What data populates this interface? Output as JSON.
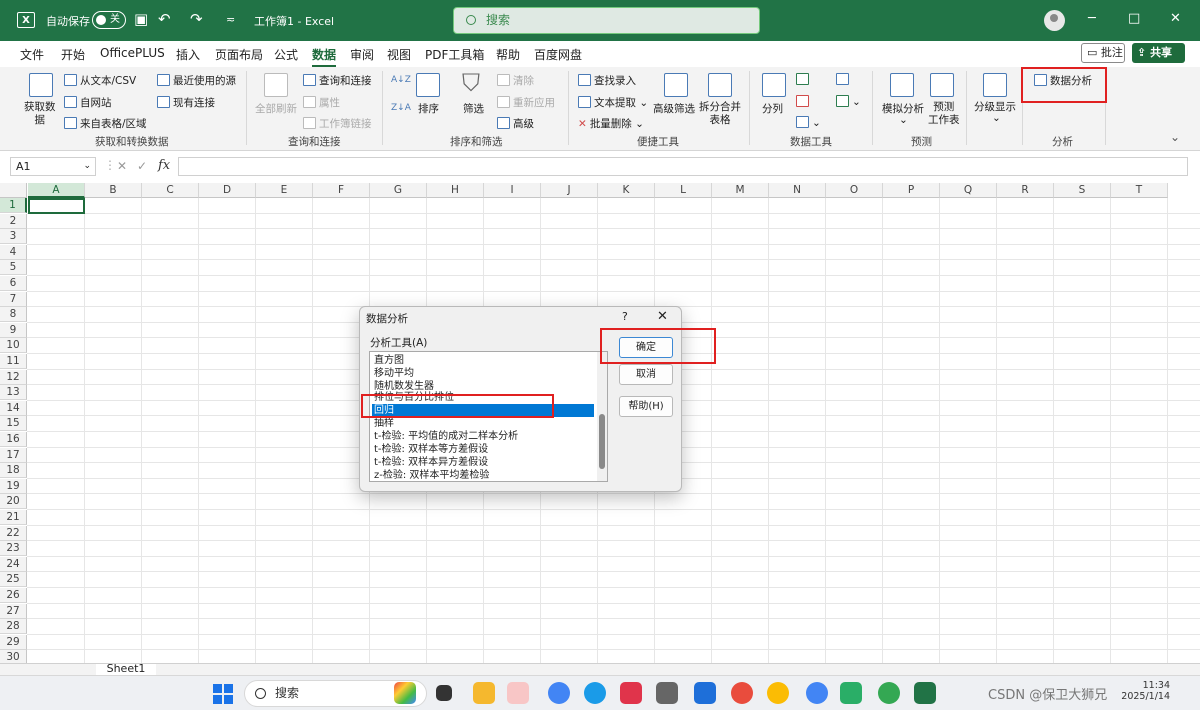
{
  "title_bar": {
    "app_icon": "X",
    "autosave_label": "自动保存",
    "autosave_state": "关",
    "save_icon": "save-icon",
    "undo_icon": "undo-icon",
    "redo_icon": "redo-icon",
    "doc_title": "工作簿1 - Excel",
    "search_placeholder": "搜索",
    "minimize": "─",
    "maximize": "□",
    "close": "✕",
    "accent_color": "#217346"
  },
  "menu": {
    "tabs": [
      "文件",
      "开始",
      "OfficePLUS",
      "插入",
      "页面布局",
      "公式",
      "数据",
      "审阅",
      "视图",
      "PDF工具箱",
      "帮助",
      "百度网盘"
    ],
    "active_tab": "数据",
    "comment_label": "批注",
    "share_label": "共享"
  },
  "ribbon": {
    "get_data": "获取数\n据",
    "from_text": "从文本/CSV",
    "from_web": "自网站",
    "from_table": "来自表格/区域",
    "recent_sources": "最近使用的源",
    "existing_conn": "现有连接",
    "group_get": "获取和转换数据",
    "refresh_all": "全部刷新",
    "queries_conn": "查询和连接",
    "properties": "属性",
    "workbook_links": "工作簿链接",
    "group_queries": "查询和连接",
    "sort": "排序",
    "filter": "筛选",
    "clear": "清除",
    "reapply": "重新应用",
    "advanced": "高级",
    "group_sort": "排序和筛选",
    "find_entry": "查找录入",
    "text_extract": "文本提取",
    "batch_delete": "批量删除",
    "advanced_filter": "高级筛选",
    "split_merge": "拆分合并\n表格",
    "group_tools": "便捷工具",
    "text_to_cols": "分列",
    "group_data_tools": "数据工具",
    "what_if": "模拟分析",
    "forecast_sheet": "预测\n工作表",
    "group_forecast": "预测",
    "outline": "分级显示",
    "data_analysis": "数据分析",
    "group_analysis": "分析"
  },
  "formula_bar": {
    "name_box": "A1",
    "fx": "fx",
    "value": ""
  },
  "grid": {
    "columns": [
      "A",
      "B",
      "C",
      "D",
      "E",
      "F",
      "G",
      "H",
      "I",
      "J",
      "K",
      "L",
      "M",
      "N",
      "O",
      "P",
      "Q",
      "R",
      "S",
      "T"
    ],
    "rows": [
      "1",
      "2",
      "3",
      "4",
      "5",
      "6",
      "7",
      "8",
      "9",
      "10",
      "11",
      "12",
      "13",
      "14",
      "15",
      "16",
      "17",
      "18",
      "19",
      "20",
      "21",
      "22",
      "23",
      "24",
      "25",
      "26",
      "27",
      "28",
      "29",
      "30"
    ],
    "active_cell": "A1"
  },
  "sheet_tab": "Sheet1",
  "dialog": {
    "title": "数据分析",
    "help_q": "?",
    "close": "✕",
    "list_label": "分析工具(A)",
    "items": [
      "直方图",
      "移动平均",
      "随机数发生器",
      "排位与百分比排位",
      "回归",
      "抽样",
      "t-检验: 平均值的成对二样本分析",
      "t-检验: 双样本等方差假设",
      "t-检验: 双样本异方差假设",
      "z-检验: 双样本平均差检验"
    ],
    "selected_item": "回归",
    "ok_label": "确定",
    "cancel_label": "取消",
    "help_label": "帮助(H)"
  },
  "taskbar": {
    "search_label": "搜索",
    "tray_text": "CSDN @保卫大狮兄",
    "time": "11:34",
    "date": "2025/1/14"
  }
}
